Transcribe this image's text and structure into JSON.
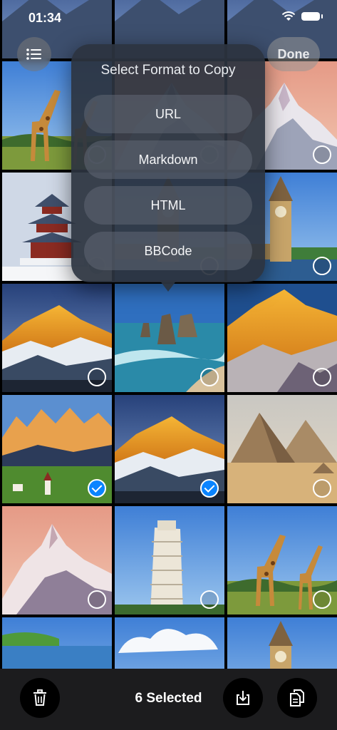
{
  "status_bar": {
    "time": "01:34"
  },
  "header": {
    "done_label": "Done"
  },
  "popover": {
    "title": "Select Format to Copy",
    "options": [
      "URL",
      "Markdown",
      "HTML",
      "BBCode"
    ]
  },
  "photos": [
    {
      "subject": "scenery",
      "selected": false
    },
    {
      "subject": "scenery",
      "selected": false
    },
    {
      "subject": "scenery",
      "selected": false
    },
    {
      "subject": "giraffes",
      "selected": false
    },
    {
      "subject": "mountain peak",
      "selected": false
    },
    {
      "subject": "mountain peak",
      "selected": false
    },
    {
      "subject": "temple of heaven in snow",
      "selected": false
    },
    {
      "subject": "big ben",
      "selected": false
    },
    {
      "subject": "big ben",
      "selected": false
    },
    {
      "subject": "snowy mountain at sunrise",
      "selected": false
    },
    {
      "subject": "sea stacks on coast",
      "selected": false
    },
    {
      "subject": "golden mountain",
      "selected": false
    },
    {
      "subject": "dolomites village",
      "selected": true
    },
    {
      "subject": "snowy mountain at sunrise",
      "selected": true
    },
    {
      "subject": "pyramids of giza",
      "selected": false
    },
    {
      "subject": "pink mountain",
      "selected": false
    },
    {
      "subject": "leaning tower of pisa",
      "selected": false
    },
    {
      "subject": "giraffes",
      "selected": false
    },
    {
      "subject": "cliffs",
      "selected": false
    },
    {
      "subject": "clouds",
      "selected": false
    },
    {
      "subject": "big ben",
      "selected": false
    }
  ],
  "bottom_bar": {
    "selected_count": "6 Selected",
    "icons": [
      "trash-icon",
      "save-icon",
      "copy-icon"
    ]
  }
}
